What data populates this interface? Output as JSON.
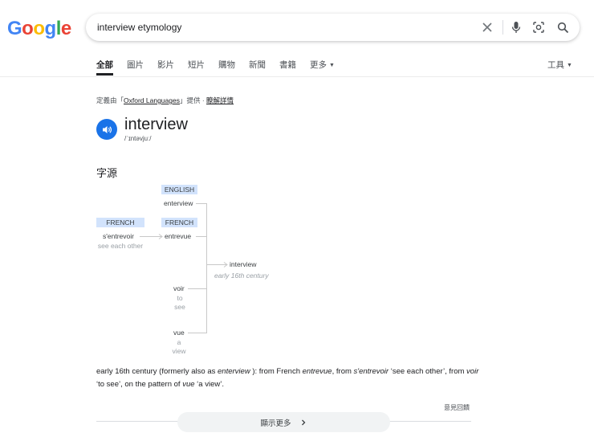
{
  "logo": {
    "letters": [
      "G",
      "o",
      "o",
      "g",
      "l",
      "e"
    ],
    "colors": [
      "#4285F4",
      "#EA4335",
      "#FBBC05",
      "#4285F4",
      "#34A853",
      "#EA4335"
    ]
  },
  "search": {
    "query": "interview etymology"
  },
  "tabs": [
    "全部",
    "圖片",
    "影片",
    "短片",
    "購物",
    "新聞",
    "書籍",
    "更多"
  ],
  "tools_label": "工具",
  "source": {
    "prefix": "定義由「",
    "name": "Oxford Languages",
    "suffix": "」提供 · ",
    "learn_more": "瞭解詳情"
  },
  "word": {
    "headword": "interview",
    "phonetic": "/ˈɪntəvjuː/"
  },
  "etymology": {
    "heading": "字源",
    "nodes": [
      {
        "lang": "ENGLISH",
        "word": "enterview",
        "gloss": ""
      },
      {
        "lang": "FRENCH",
        "word": "s'entrevoir",
        "gloss": "see each other"
      },
      {
        "lang": "FRENCH",
        "word": "entrevue",
        "gloss": ""
      },
      {
        "lang": "",
        "word": "voir",
        "gloss": "to see"
      },
      {
        "lang": "",
        "word": "vue",
        "gloss": "a view"
      },
      {
        "lang": "",
        "word": "interview",
        "gloss": "",
        "date": "early 16th century"
      }
    ],
    "description": {
      "p1": "early 16th century (formerly also as ",
      "i1": "enterview",
      "p2": " ): from French ",
      "i2": "entrevue",
      "p3": ", from ",
      "i3": "s'entrevoir",
      "p4": " ‘see each other’, from ",
      "i4": "voir",
      "p5": " ‘to see’, on the pattern of ",
      "i5": "vue",
      "p6": " ‘a view’."
    }
  },
  "feedback_label": "意見回饋",
  "show_more_label": "顯示更多"
}
